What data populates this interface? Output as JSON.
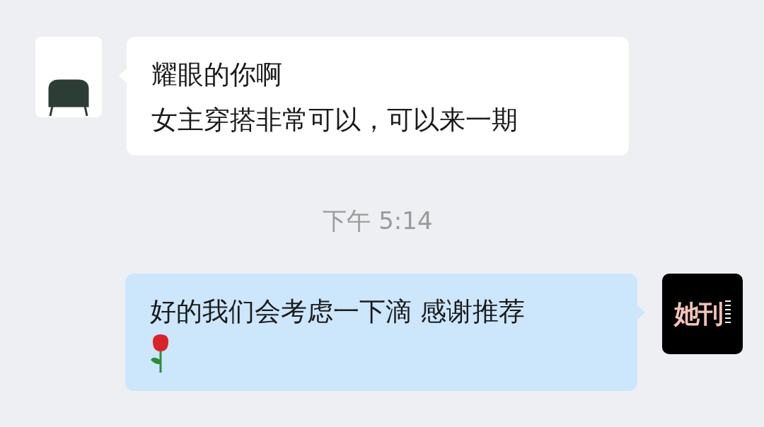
{
  "messages": [
    {
      "kind": "received",
      "lines": [
        "耀眼的你啊",
        "女主穿搭非常可以，可以来一期"
      ]
    },
    {
      "kind": "time",
      "text": "下午 5:14"
    },
    {
      "kind": "sent",
      "lines": [
        "好的我们会考虑一下滴 感谢推荐"
      ],
      "logo": "她刊"
    }
  ]
}
